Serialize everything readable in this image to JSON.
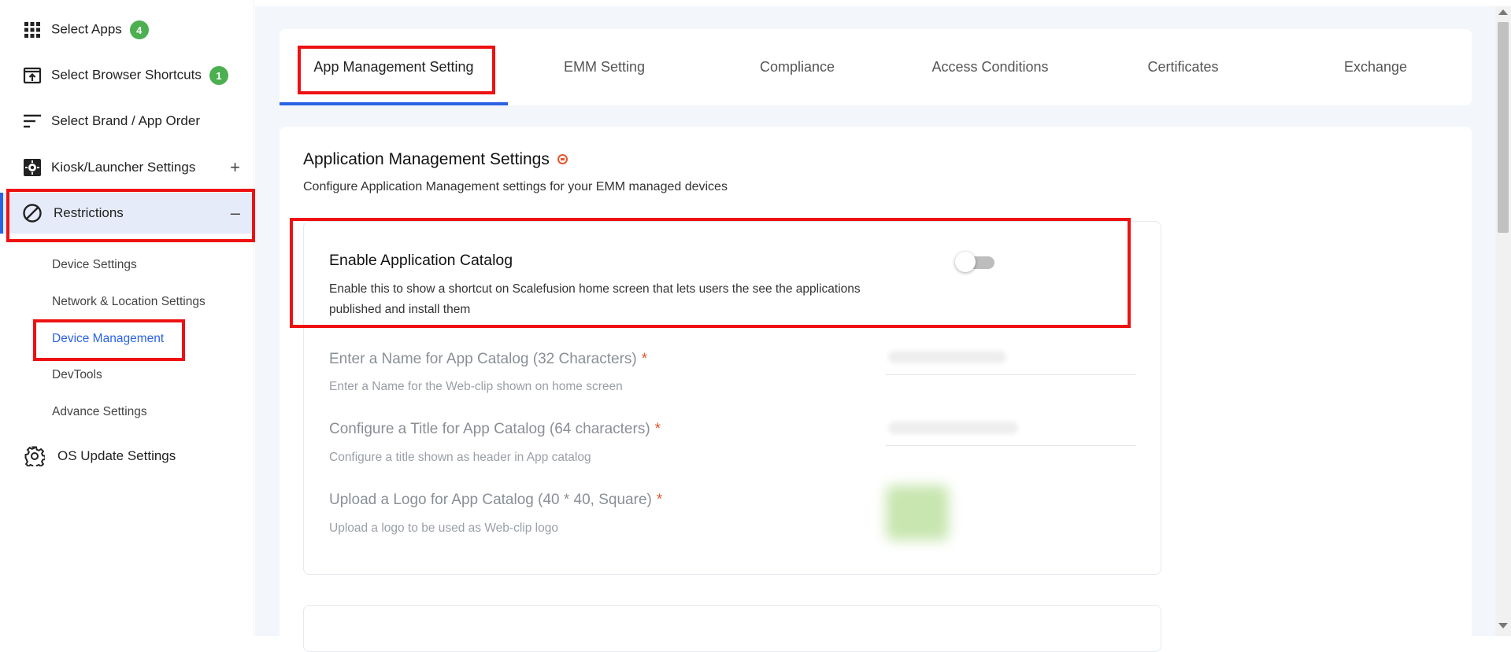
{
  "sidebar": {
    "items": [
      {
        "label": "Select Apps",
        "badge": "4",
        "icon": "grid-apps-icon"
      },
      {
        "label": "Select Browser Shortcuts",
        "badge": "1",
        "icon": "browser-shortcut-icon"
      },
      {
        "label": "Select Brand / App Order",
        "icon": "sort-lines-icon"
      },
      {
        "label": "Kiosk/Launcher Settings",
        "toggle": "+",
        "icon": "kiosk-icon"
      },
      {
        "label": "Restrictions",
        "toggle": "–",
        "icon": "prohibited-icon"
      },
      {
        "label": "OS Update Settings",
        "icon": "gear-icon"
      }
    ],
    "subitems": [
      "Device Settings",
      "Network & Location Settings",
      "Device Management",
      "DevTools",
      "Advance Settings"
    ]
  },
  "tabs": [
    "App Management Setting",
    "EMM Setting",
    "Compliance",
    "Access Conditions",
    "Certificates",
    "Exchange"
  ],
  "section": {
    "title": "Application Management Settings",
    "subtitle": "Configure Application Management settings for your EMM managed devices"
  },
  "catalog": {
    "title": "Enable Application Catalog",
    "description": "Enable this to show a shortcut on Scalefusion home screen that lets users the see the applications published and install them",
    "enabled": false
  },
  "fields": [
    {
      "label": "Enter a Name for App Catalog (32 Characters)",
      "required": "*",
      "help": "Enter a Name for the Web-clip shown on home screen"
    },
    {
      "label": "Configure a Title for App Catalog (64 characters)",
      "required": "*",
      "help": "Configure a title shown as header in App catalog"
    },
    {
      "label": "Upload a Logo for App Catalog (40 * 40, Square)",
      "required": "*",
      "help": "Upload a logo to be used as Web-clip logo"
    }
  ],
  "colors": {
    "accent": "#2a62e4",
    "highlight_box": "#ee1111",
    "badge": "#4caf50",
    "active_bg": "#e6ebfa",
    "required": "#e4572e"
  }
}
